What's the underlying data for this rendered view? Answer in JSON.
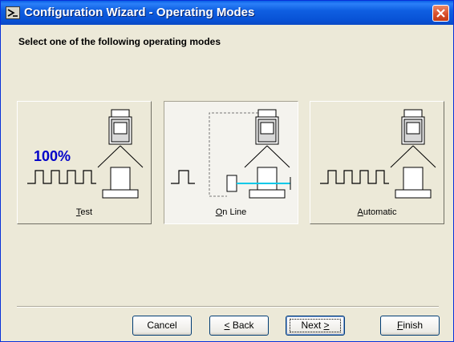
{
  "window": {
    "title": "Configuration Wizard - Operating Modes"
  },
  "instruction": "Select one of the following operating modes",
  "modes": [
    {
      "accel": "T",
      "rest": "est",
      "label": "Test",
      "badge": "100%",
      "selected": false
    },
    {
      "accel": "O",
      "rest": "n Line",
      "label": "On Line",
      "selected": true
    },
    {
      "accel": "A",
      "rest": "utomatic",
      "label": "Automatic",
      "selected": false
    }
  ],
  "buttons": {
    "cancel": "Cancel",
    "back": {
      "pre": "",
      "accel": "<",
      "post": " Back"
    },
    "next": {
      "pre": "Next ",
      "accel": ">",
      "post": ""
    },
    "finish": {
      "pre": "",
      "accel": "F",
      "post": "inish"
    }
  },
  "colors": {
    "title_bar": "#0a5fe6",
    "close": "#d9502c",
    "laser": "#00c8e8",
    "badge": "#0000c8"
  },
  "icons": {
    "title": "wizard-icon",
    "close": "close-icon"
  }
}
